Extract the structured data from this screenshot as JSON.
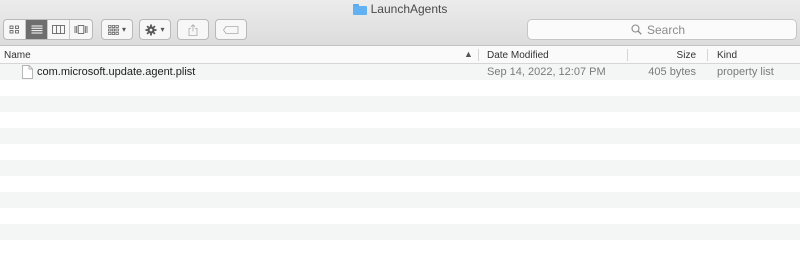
{
  "window": {
    "title": "LaunchAgents",
    "title_icon": "folder-icon"
  },
  "toolbar": {
    "view_buttons": [
      "icon-view-icon",
      "list-view-icon",
      "column-view-icon",
      "gallery-view-icon"
    ],
    "active_view": "list-view-icon",
    "group_icon": "group-by-icon",
    "action_icon": "gear-icon",
    "share_icon": "share-icon",
    "tag_icon": "tag-icon"
  },
  "search": {
    "placeholder": "Search"
  },
  "columns": [
    {
      "label": "Name",
      "sort": "ascending"
    },
    {
      "label": "Date Modified"
    },
    {
      "label": "Size"
    },
    {
      "label": "Kind"
    }
  ],
  "files": [
    {
      "name": "com.microsoft.update.agent.plist",
      "date_modified": "Sep 14, 2022, 12:07 PM",
      "size": "405 bytes",
      "kind": "property list",
      "icon": "document-icon"
    }
  ],
  "colors": {
    "folder": "#62b2f3",
    "row_alt": "#f4f5f5",
    "active_view": "#6e6e6e"
  }
}
